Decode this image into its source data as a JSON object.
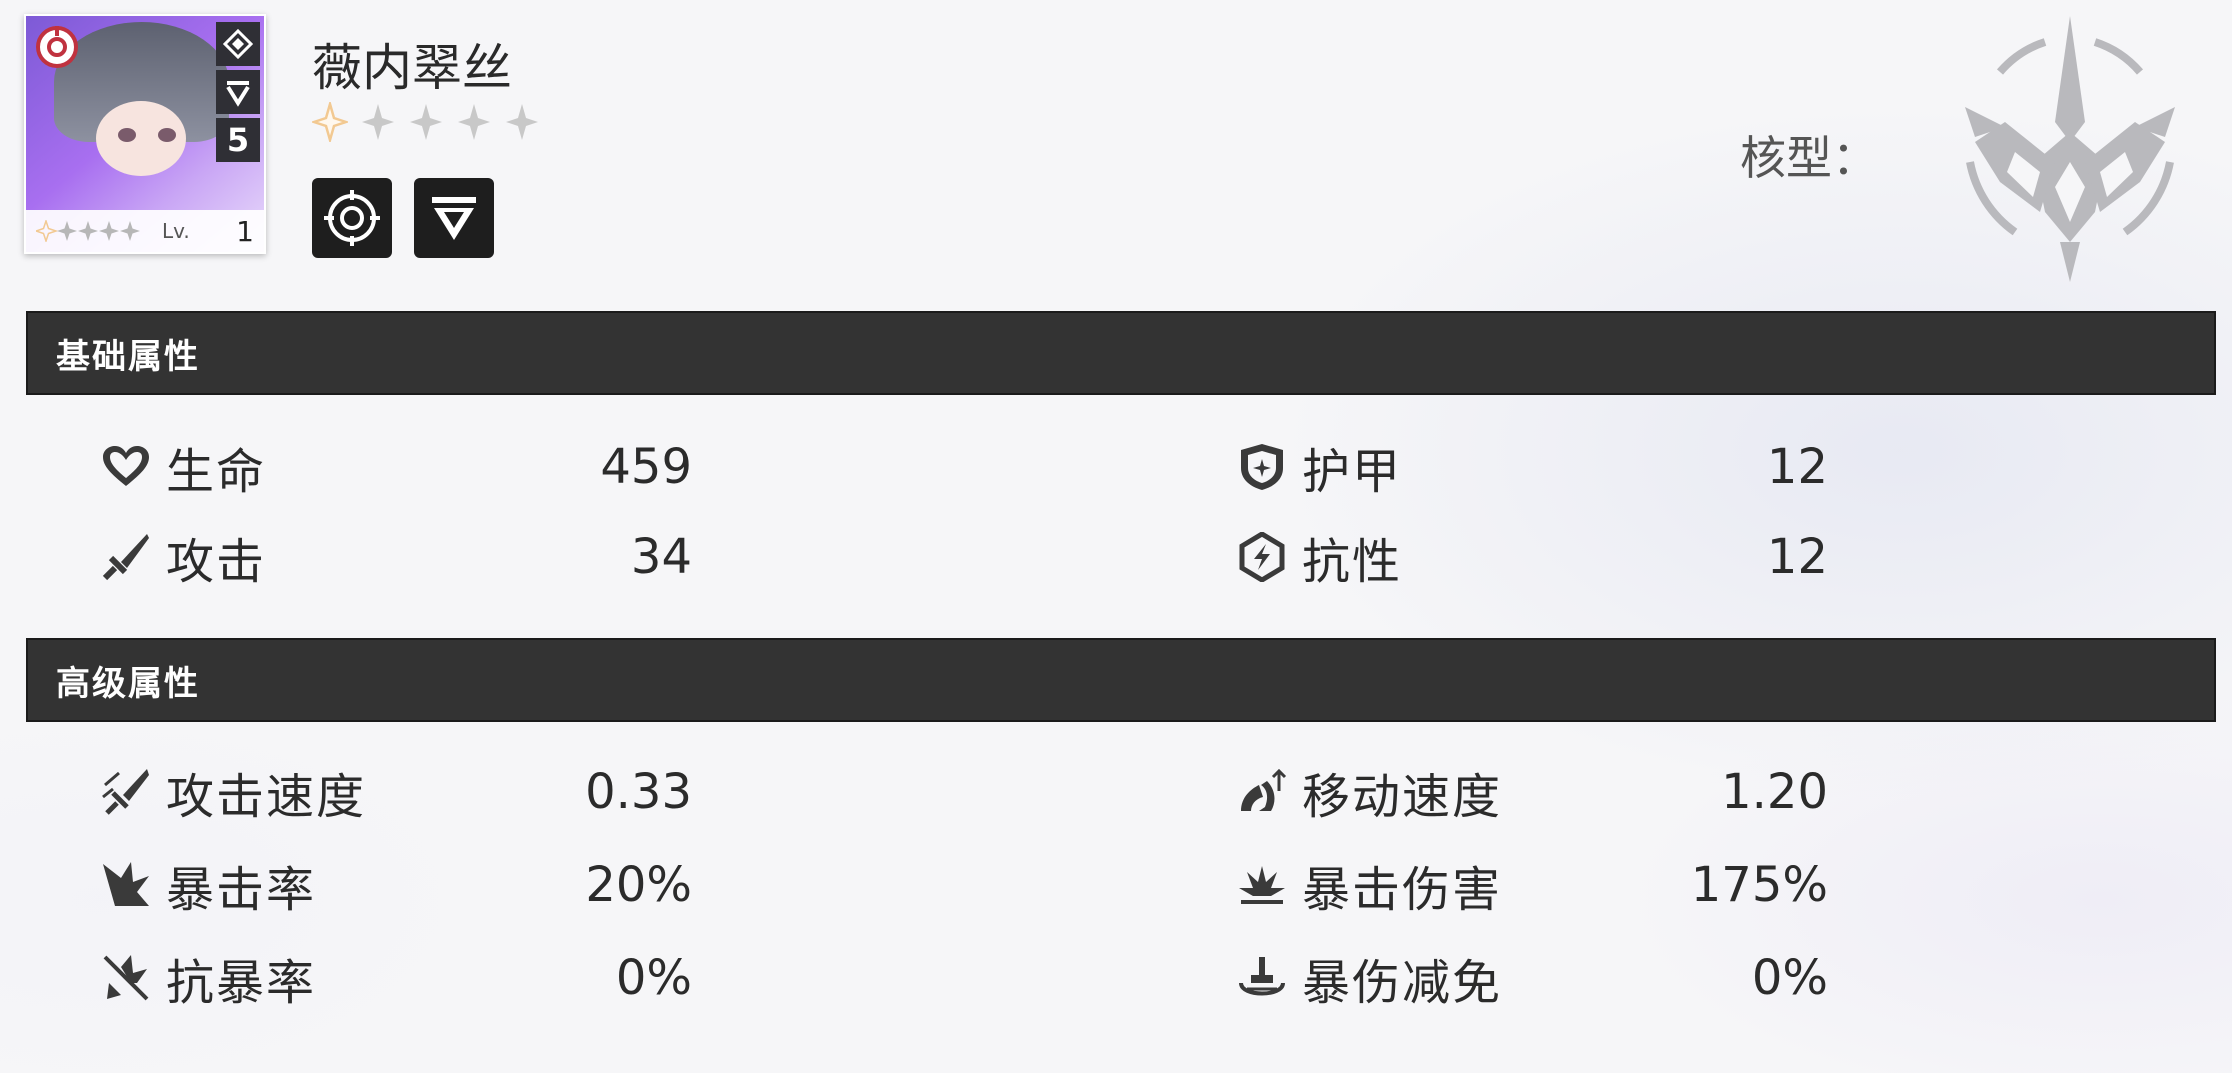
{
  "character": {
    "name": "薇内翠丝",
    "level_label": "Lv.",
    "level": "1",
    "stars_total": 5,
    "stars_filled": 1,
    "rank": "5",
    "core_label": "核型："
  },
  "sections": {
    "basic": {
      "title": "基础属性",
      "stats": [
        {
          "label": "生命",
          "value": "459",
          "icon": "heart-icon"
        },
        {
          "label": "攻击",
          "value": "34",
          "icon": "sword-icon"
        },
        {
          "label": "护甲",
          "value": "12",
          "icon": "shield-icon"
        },
        {
          "label": "抗性",
          "value": "12",
          "icon": "resist-icon"
        }
      ]
    },
    "advanced": {
      "title": "高级属性",
      "stats": [
        {
          "label": "攻击速度",
          "value": "0.33",
          "icon": "attack-speed-icon"
        },
        {
          "label": "暴击率",
          "value": "20%",
          "icon": "crit-rate-icon"
        },
        {
          "label": "抗暴率",
          "value": "0%",
          "icon": "crit-resist-icon"
        },
        {
          "label": "移动速度",
          "value": "1.20",
          "icon": "move-speed-icon"
        },
        {
          "label": "暴击伤害",
          "value": "175%",
          "icon": "crit-damage-icon"
        },
        {
          "label": "暴伤减免",
          "value": "0%",
          "icon": "crit-damage-reduction-icon"
        }
      ]
    }
  },
  "colors": {
    "section_bar": "#333333",
    "star_filled": "#f2c992",
    "star_empty": "#c4c4c4",
    "portrait_accent": "#a86ff0"
  }
}
